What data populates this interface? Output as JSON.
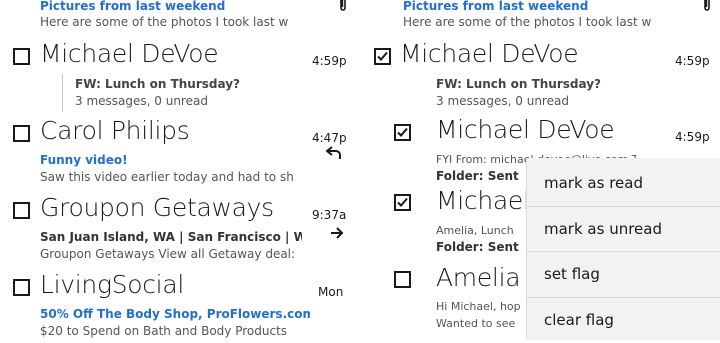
{
  "left": {
    "top_email": {
      "subject": "Pictures from last weekend",
      "preview": "Here are some of the photos I took last w"
    },
    "emails": [
      {
        "sender": "Michael DeVoe",
        "time": "4:59p",
        "subject": "FW: Lunch on Thursday?",
        "preview": "3 messages, 0 unread"
      },
      {
        "sender": "Carol Philips",
        "time": "4:47p",
        "subject": "Funny video!",
        "preview": "Saw this video earlier today and had to sh"
      },
      {
        "sender": "Groupon Getaways",
        "time": "9:37a",
        "subject": "San Juan Island, WA | San Francisco | Wir",
        "preview": "Groupon Getaways View all Getaway deal:"
      },
      {
        "sender": "LivingSocial",
        "time": "Mon",
        "subject": "50% Off The Body Shop, ProFlowers.com",
        "preview": "$20 to Spend on Bath and Body Products"
      }
    ]
  },
  "right": {
    "top_email": {
      "subject": "Pictures from last weekend",
      "preview": "Here are some of the photos I took last w"
    },
    "thread": {
      "sender": "Michael DeVoe",
      "time": "4:59p",
      "subject": "FW: Lunch on Thursday?",
      "preview": "3 messages, 0 unread"
    },
    "children": [
      {
        "sender": "Michael DeVoe",
        "time": "4:59p",
        "preview": "FYI From: michael.devoe@live.com T",
        "folder": "Folder: Sent",
        "checked": true
      },
      {
        "sender": "Michael",
        "preview": "Amelia,  Lunch",
        "folder": "Folder: Sent",
        "checked": true
      },
      {
        "sender": "Amelia /",
        "preview": "Hi Michael, hop",
        "preview2": "Wanted to see",
        "checked": false
      }
    ]
  },
  "context_menu": {
    "items": [
      "mark as read",
      "mark as unread",
      "set flag",
      "clear flag"
    ]
  },
  "icons": {
    "attachment": "paperclip-icon",
    "reply": "reply-icon",
    "forward": "forward-icon"
  }
}
